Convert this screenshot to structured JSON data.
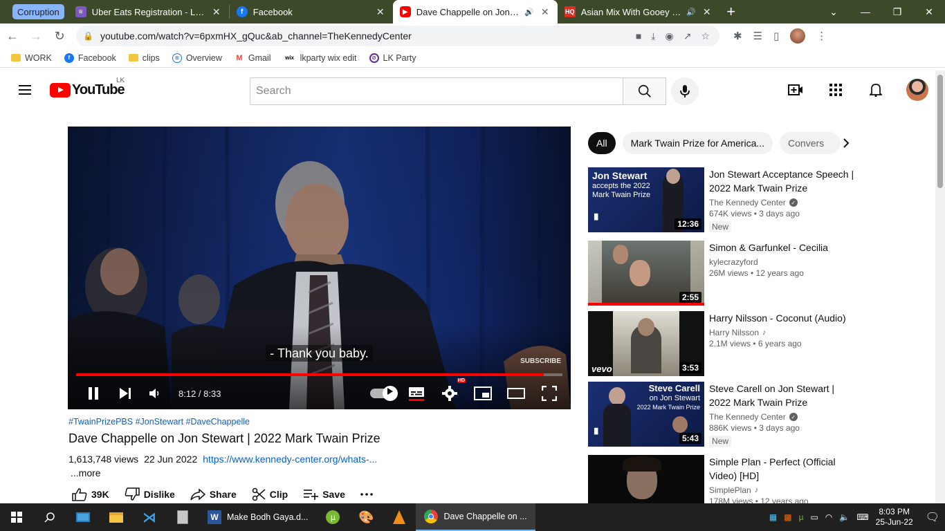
{
  "browser": {
    "tab_group": "Corruption",
    "tabs": [
      {
        "title": "Uber Eats Registration - Let's Get",
        "icon": "list-icon"
      },
      {
        "title": "Facebook",
        "icon": "facebook-icon"
      },
      {
        "title": "Dave Chappelle on Jon Stewart",
        "icon": "youtube-icon",
        "active": true
      },
      {
        "title": "Asian Mix With Gooey Sauce",
        "icon": "hq-icon"
      }
    ],
    "url": "youtube.com/watch?v=6pxmHX_gQuc&ab_channel=TheKennedyCenter",
    "bookmarks": [
      "WORK",
      "Facebook",
      "clips",
      "Overview",
      "Gmail",
      "lkparty wix edit",
      "LK Party"
    ]
  },
  "youtube": {
    "region": "LK",
    "logo_text": "YouTube",
    "search_placeholder": "Search"
  },
  "player": {
    "caption": "- Thank you baby.",
    "watermark": "SUBSCRIBE",
    "current_time": "8:12",
    "duration": "8:33",
    "time_display": "8:12 / 8:33",
    "progress_fraction": 0.961,
    "hd_badge": "HD"
  },
  "video": {
    "tags": "#TwainPrizePBS #JonStewart #DaveChappelle",
    "title": "Dave Chappelle on Jon Stewart | 2022 Mark Twain Prize",
    "views": "1,613,748 views",
    "date": "22 Jun 2022",
    "link": "https://www.kennedy-center.org/whats-...",
    "more": "...more",
    "actions": {
      "like_count": "39K",
      "dislike": "Dislike",
      "share": "Share",
      "clip": "Clip",
      "save": "Save"
    }
  },
  "sidebar": {
    "chips": [
      "All",
      "Mark Twain Prize for America...",
      "Convers"
    ],
    "recommendations": [
      {
        "title": "Jon Stewart Acceptance Speech | 2022 Mark Twain Prize",
        "channel": "The Kennedy Center",
        "verified": true,
        "stats": "674K views • 3 days ago",
        "badge": "New",
        "duration": "12:36",
        "thumb_text_1": "Jon Stewart",
        "thumb_text_2": "accepts the 2022",
        "thumb_text_3": "Mark Twain Prize"
      },
      {
        "title": "Simon & Garfunkel - Cecilia",
        "channel": "kylecrazyford",
        "verified": false,
        "stats": "26M views • 12 years ago",
        "duration": "2:55",
        "watched_fraction": 1.0
      },
      {
        "title": "Harry Nilsson - Coconut (Audio)",
        "channel": "Harry Nilsson",
        "music": true,
        "stats": "2.1M views • 6 years ago",
        "duration": "3:53",
        "thumb_text_1": "vevo"
      },
      {
        "title": "Steve Carell on Jon Stewart | 2022 Mark Twain Prize",
        "channel": "The Kennedy Center",
        "verified": true,
        "stats": "886K views • 3 days ago",
        "badge": "New",
        "duration": "5:43",
        "thumb_text_1": "Steve Carell",
        "thumb_text_2": "on Jon Stewart",
        "thumb_text_3": "2022 Mark Twain Prize"
      },
      {
        "title": "Simple Plan - Perfect (Official Video) [HD]",
        "channel": "SimplePlan",
        "music": true,
        "stats": "178M views • 12 years ago"
      }
    ]
  },
  "taskbar": {
    "word_doc": "Make Bodh Gaya.d...",
    "chrome_window": "Dave Chappelle on ...",
    "time": "8:03 PM",
    "date": "25-Jun-22"
  }
}
